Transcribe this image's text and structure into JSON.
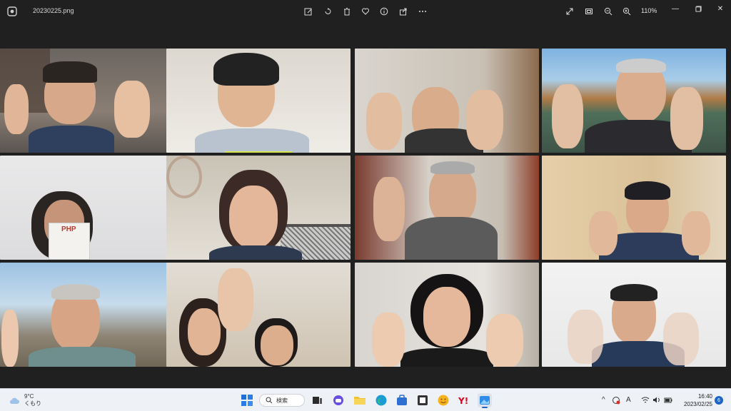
{
  "window": {
    "filename": "20230225.png",
    "zoom": "110%"
  },
  "toolbar": {
    "icons": [
      "edit-icon",
      "rotate-icon",
      "delete-icon",
      "favorite-icon",
      "info-icon",
      "share-icon",
      "more-icon"
    ],
    "right_icons": [
      "fullscreen-icon",
      "fit-icon",
      "zoom-out-icon",
      "zoom-in-icon"
    ]
  },
  "participants": [
    {
      "id": 1,
      "row": 0,
      "col": 0,
      "active": false
    },
    {
      "id": 2,
      "row": 0,
      "col": 1,
      "active": false
    },
    {
      "id": 3,
      "row": 0,
      "col": 2,
      "active": false
    },
    {
      "id": 4,
      "row": 0,
      "col": 3,
      "active": false
    },
    {
      "id": 5,
      "row": 1,
      "col": 0,
      "active": false
    },
    {
      "id": 6,
      "row": 1,
      "col": 1,
      "active": false
    },
    {
      "id": 7,
      "row": 1,
      "col": 2,
      "active": false
    },
    {
      "id": 8,
      "row": 1,
      "col": 3,
      "active": true
    },
    {
      "id": 9,
      "row": 2,
      "col": 0,
      "active": false
    },
    {
      "id": 10,
      "row": 2,
      "col": 1,
      "active": false
    },
    {
      "id": 11,
      "row": 2,
      "col": 2,
      "active": false
    },
    {
      "id": 12,
      "row": 2,
      "col": 3,
      "active": false
    }
  ],
  "book_cover_text": "PHP",
  "taskbar": {
    "weather_temp": "9°C",
    "weather_desc": "くもり",
    "search_label": "検索",
    "time": "16:40",
    "date": "2023/02/25",
    "notification_count": "6",
    "ime": "A"
  },
  "colors": {
    "active_border": "#d6e34a",
    "titlebar_bg": "#202020",
    "taskbar_bg": "#eef1f6"
  }
}
